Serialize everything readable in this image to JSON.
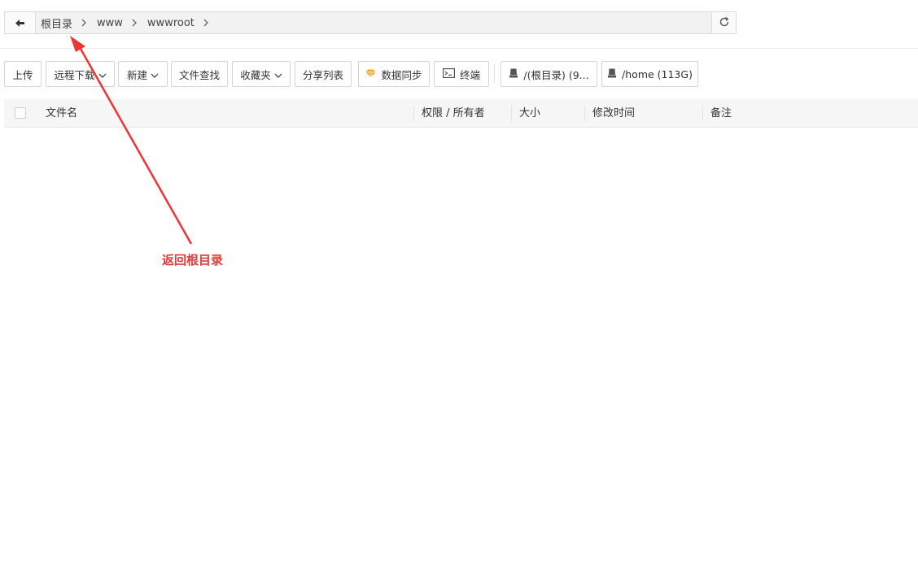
{
  "breadcrumb": {
    "items": [
      "根目录",
      "www",
      "wwwroot"
    ]
  },
  "toolbar": {
    "upload": "上传",
    "remote_download": "远程下载",
    "new": "新建",
    "file_search": "文件查找",
    "favorites": "收藏夹",
    "share_list": "分享列表",
    "data_sync": "数据同步",
    "terminal": "终端",
    "disk_root": "/(根目录) (9...",
    "disk_home": "/home (113G)"
  },
  "table": {
    "columns": [
      "文件名",
      "权限 / 所有者",
      "大小",
      "修改时间",
      "备注"
    ]
  },
  "annotation": {
    "text": "返回根目录",
    "color": "#e23b3b"
  },
  "colors": {
    "sync_icon": "#f5a623"
  }
}
